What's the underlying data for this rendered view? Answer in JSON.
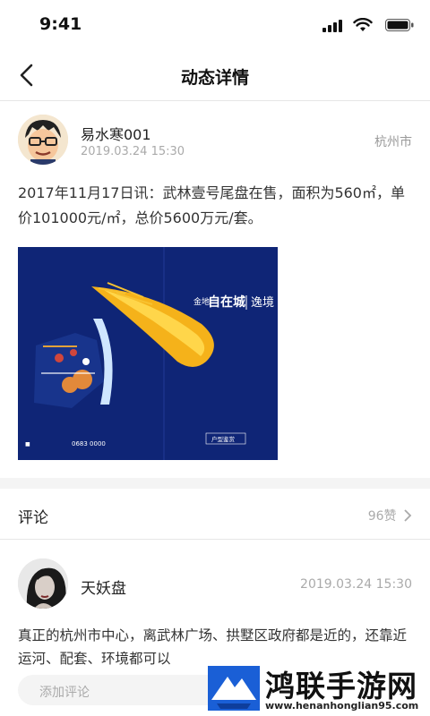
{
  "status": {
    "time": "9:41"
  },
  "nav": {
    "title": "动态详情"
  },
  "post": {
    "author_name": "易水寒001",
    "time": "2019.03.24 15:30",
    "city": "杭州市",
    "text": "2017年11月17日讯：武林壹号尾盘在售，面积为560㎡，单价101000元/㎡，总价5600万元/套。",
    "image": {
      "brand": "金地",
      "brand_name": "自在城",
      "tagline": "逸境",
      "phone": "0683 0000",
      "button": "户型鉴赏"
    }
  },
  "comments_section": {
    "label": "评论",
    "likes": "96赞"
  },
  "comment": {
    "name": "天妖盘",
    "time": "2019.03.24 15:30",
    "text": "真正的杭州市中心，离武林广场、拱墅区政府都是近的，还靠近运河、配套、环境都可以"
  },
  "input": {
    "placeholder": "添加评论"
  },
  "watermark": {
    "title": "鸿联手游网",
    "url": "www.henanhonglian95.com"
  },
  "colors": {
    "poster_bg": "#0f2576",
    "flame": "#f5b21a",
    "watermark_blue": "#1a5fd6"
  }
}
